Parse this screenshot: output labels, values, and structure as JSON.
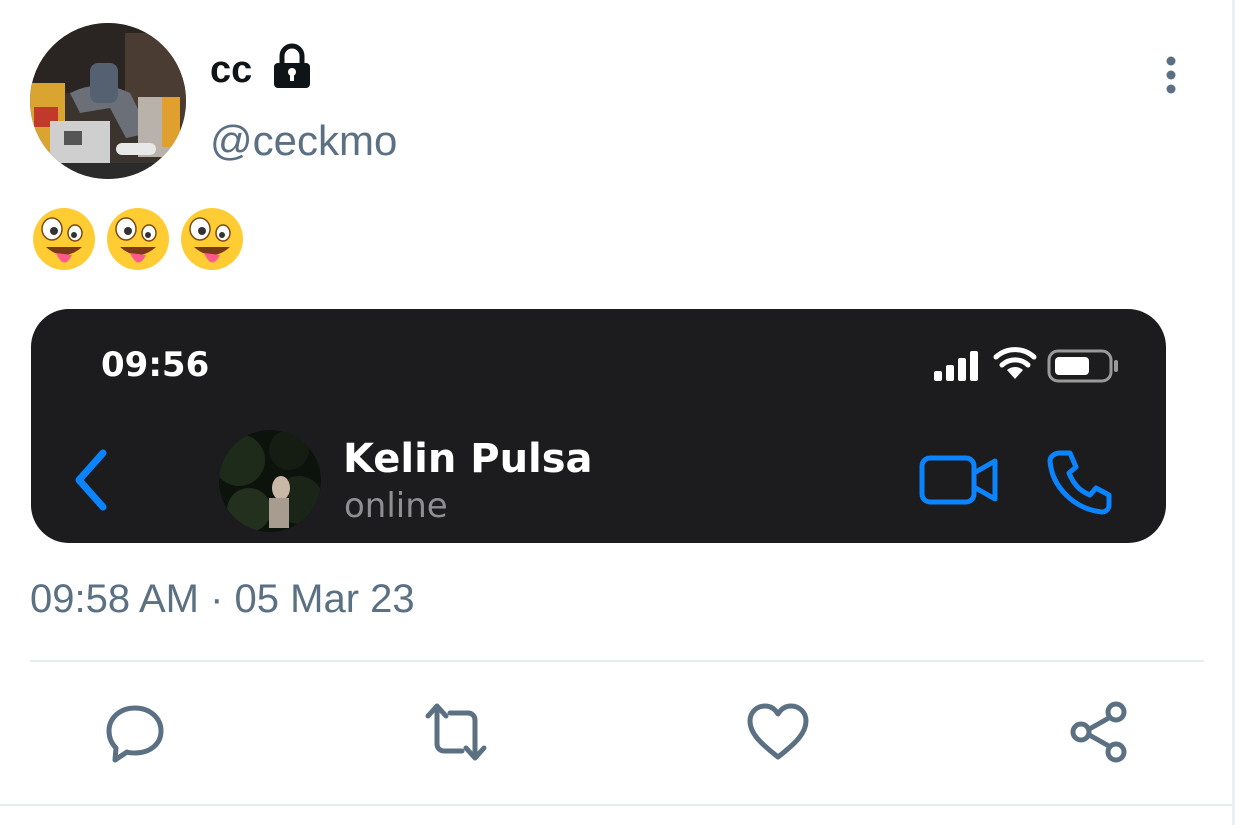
{
  "tweet": {
    "display_name": "cc",
    "handle": "@ceckmo",
    "protected_icon": "lock-icon",
    "emoji": [
      "🤪",
      "🤪",
      "🤪"
    ],
    "timestamp": "09:58 AM · 05 Mar 23"
  },
  "screenshot_card": {
    "status_time": "09:56",
    "contact_name": "Kelin Pulsa",
    "contact_status": "online",
    "accent_color": "#0a84ff",
    "background_color": "#1c1c1e"
  },
  "actions": {
    "reply_icon": "comment-icon",
    "retweet_icon": "retweet-icon",
    "like_icon": "heart-icon",
    "share_icon": "share-icon"
  },
  "colors": {
    "text_primary": "#0f1419",
    "text_secondary": "#5b7083",
    "divider": "#e6ecf0"
  }
}
